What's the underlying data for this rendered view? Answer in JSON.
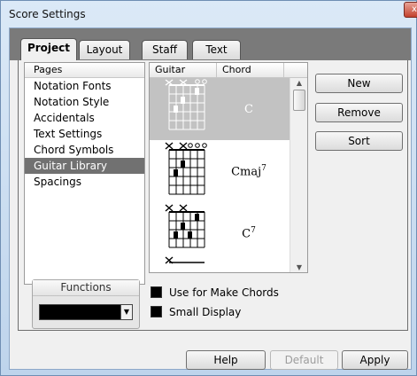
{
  "window": {
    "title": "Score Settings",
    "close_glyph": "x"
  },
  "tabs": [
    {
      "label": "Project",
      "active": true
    },
    {
      "label": "Layout",
      "active": false
    },
    {
      "label": "Staff",
      "active": false
    },
    {
      "label": "Text",
      "active": false
    }
  ],
  "pages": {
    "header": "Pages",
    "items": [
      "Notation Fonts",
      "Notation Style",
      "Accidentals",
      "Text Settings",
      "Chord Symbols",
      "Guitar Library",
      "Spacings"
    ],
    "selected": "Guitar Library"
  },
  "library": {
    "columns": [
      "Guitar",
      "Chord"
    ],
    "chords": [
      {
        "root": "C",
        "suffix": "",
        "sup": "",
        "selected": true
      },
      {
        "root": "C",
        "suffix": "maj",
        "sup": "7",
        "selected": false
      },
      {
        "root": "C",
        "suffix": "",
        "sup": "7",
        "selected": false
      }
    ]
  },
  "buttons": {
    "new": "New",
    "remove": "Remove",
    "sort": "Sort"
  },
  "functions": {
    "title": "Functions",
    "value": ""
  },
  "options": {
    "use_for_make_chords": "Use for Make Chords",
    "small_display": "Small Display"
  },
  "footer": {
    "help": "Help",
    "default": "Default",
    "apply": "Apply"
  },
  "colors": {
    "selection": "#717171",
    "accent_title": "#bed4ec",
    "close": "#c3412d"
  }
}
